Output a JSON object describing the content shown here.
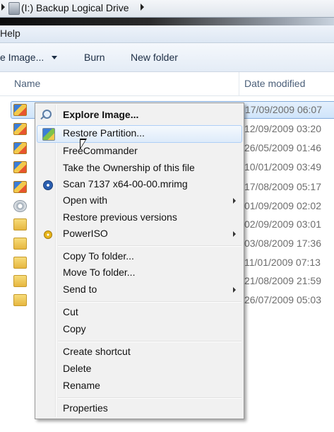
{
  "address": {
    "path": "(I:) Backup Logical Drive"
  },
  "menubar": {
    "help": "Help"
  },
  "toolbar": {
    "image_menu": "e Image...",
    "burn": "Burn",
    "new_folder": "New folder"
  },
  "columns": {
    "name": "Name",
    "date_modified": "Date modified"
  },
  "files": [
    {
      "date": "17/09/2009 06:07",
      "icon": "image-folder-icon"
    },
    {
      "date": "12/09/2009 03:20",
      "icon": "image-folder-icon"
    },
    {
      "date": "26/05/2009 01:46",
      "icon": "image-folder-icon"
    },
    {
      "date": "10/01/2009 03:49",
      "icon": "image-folder-icon"
    },
    {
      "date": "17/08/2009 05:17",
      "icon": "image-folder-icon"
    },
    {
      "date": "01/09/2009 02:02",
      "icon": "gear-icon"
    },
    {
      "date": "02/09/2009 03:01",
      "icon": "folder-icon"
    },
    {
      "date": "03/08/2009 17:36",
      "icon": "folder-icon"
    },
    {
      "date": "11/01/2009 07:13",
      "icon": "folder-icon"
    },
    {
      "date": "21/08/2009 21:59",
      "icon": "folder-icon"
    },
    {
      "date": "26/07/2009 05:03",
      "icon": "folder-icon"
    }
  ],
  "context_menu": {
    "explore_image": "Explore Image...",
    "restore_partition": "Restore Partition...",
    "freecommander": "FreeCommander",
    "take_ownership": "Take the Ownership of this file",
    "scan": "Scan 7137 x64-00-00.mrimg",
    "open_with": "Open with",
    "restore_previous": "Restore previous versions",
    "poweriso": "PowerISO",
    "copy_to_folder": "Copy To folder...",
    "move_to_folder": "Move To folder...",
    "send_to": "Send to",
    "cut": "Cut",
    "copy": "Copy",
    "create_shortcut": "Create shortcut",
    "delete": "Delete",
    "rename": "Rename",
    "properties": "Properties"
  }
}
